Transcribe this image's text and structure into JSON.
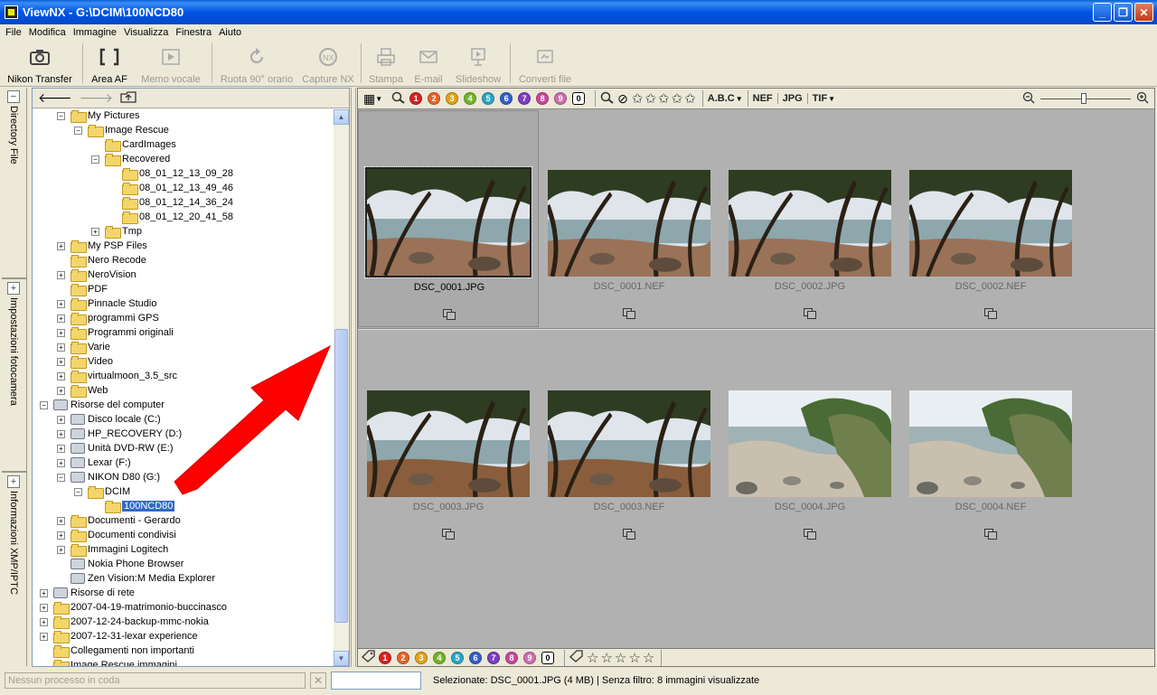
{
  "window": {
    "title": "ViewNX - G:\\DCIM\\100NCD80"
  },
  "menu": [
    "File",
    "Modifica",
    "Immagine",
    "Visualizza",
    "Finestra",
    "Aiuto"
  ],
  "toolbar": [
    {
      "label": "Nikon Transfer",
      "icon": "camera-icon",
      "enabled": true
    },
    {
      "label": "Area AF",
      "icon": "af-brackets-icon",
      "enabled": true
    },
    {
      "label": "Memo vocale",
      "icon": "voice-memo-icon",
      "enabled": false
    },
    {
      "label": "Ruota 90° orario",
      "icon": "rotate-icon",
      "enabled": false
    },
    {
      "label": "Capture NX",
      "icon": "capture-nx-icon",
      "enabled": false
    },
    {
      "label": "Stampa",
      "icon": "print-icon",
      "enabled": false
    },
    {
      "label": "E-mail",
      "icon": "email-icon",
      "enabled": false
    },
    {
      "label": "Slideshow",
      "icon": "slideshow-icon",
      "enabled": false
    },
    {
      "label": "Converti file",
      "icon": "convert-icon",
      "enabled": false
    }
  ],
  "left_tabs": [
    "Directory File",
    "Impostazioni fotocamera",
    "Informazioni XMP/IPTC"
  ],
  "tree": [
    {
      "label": "My Pictures",
      "level": 1,
      "exp": "-",
      "type": "folder"
    },
    {
      "label": "Image Rescue",
      "level": 2,
      "exp": "-",
      "type": "folder"
    },
    {
      "label": "CardImages",
      "level": 3,
      "exp": "",
      "type": "folder"
    },
    {
      "label": "Recovered",
      "level": 3,
      "exp": "-",
      "type": "folder"
    },
    {
      "label": "08_01_12_13_09_28",
      "level": 4,
      "exp": "",
      "type": "folder"
    },
    {
      "label": "08_01_12_13_49_46",
      "level": 4,
      "exp": "",
      "type": "folder"
    },
    {
      "label": "08_01_12_14_36_24",
      "level": 4,
      "exp": "",
      "type": "folder"
    },
    {
      "label": "08_01_12_20_41_58",
      "level": 4,
      "exp": "",
      "type": "folder"
    },
    {
      "label": "Tmp",
      "level": 3,
      "exp": "+",
      "type": "folder"
    },
    {
      "label": "My PSP Files",
      "level": 1,
      "exp": "+",
      "type": "folder"
    },
    {
      "label": "Nero Recode",
      "level": 1,
      "exp": "",
      "type": "folder"
    },
    {
      "label": "NeroVision",
      "level": 1,
      "exp": "+",
      "type": "folder"
    },
    {
      "label": "PDF",
      "level": 1,
      "exp": "",
      "type": "folder"
    },
    {
      "label": "Pinnacle Studio",
      "level": 1,
      "exp": "+",
      "type": "folder"
    },
    {
      "label": "programmi GPS",
      "level": 1,
      "exp": "+",
      "type": "folder"
    },
    {
      "label": "Programmi originali",
      "level": 1,
      "exp": "+",
      "type": "folder"
    },
    {
      "label": "Varie",
      "level": 1,
      "exp": "+",
      "type": "folder"
    },
    {
      "label": "Video",
      "level": 1,
      "exp": "+",
      "type": "folder"
    },
    {
      "label": "virtualmoon_3.5_src",
      "level": 1,
      "exp": "+",
      "type": "folder"
    },
    {
      "label": "Web",
      "level": 1,
      "exp": "+",
      "type": "folder"
    },
    {
      "label": "Risorse del computer",
      "level": 0,
      "exp": "-",
      "type": "drive"
    },
    {
      "label": "Disco locale (C:)",
      "level": 1,
      "exp": "+",
      "type": "drive"
    },
    {
      "label": "HP_RECOVERY (D:)",
      "level": 1,
      "exp": "+",
      "type": "drive"
    },
    {
      "label": "Unità DVD-RW (E:)",
      "level": 1,
      "exp": "+",
      "type": "drive"
    },
    {
      "label": "Lexar (F:)",
      "level": 1,
      "exp": "+",
      "type": "drive"
    },
    {
      "label": "NIKON D80 (G:)",
      "level": 1,
      "exp": "-",
      "type": "drive"
    },
    {
      "label": "DCIM",
      "level": 2,
      "exp": "-",
      "type": "folder"
    },
    {
      "label": "100NCD80",
      "level": 3,
      "exp": "",
      "type": "folder",
      "selected": true
    },
    {
      "label": "Documenti - Gerardo",
      "level": 1,
      "exp": "+",
      "type": "folder"
    },
    {
      "label": "Documenti condivisi",
      "level": 1,
      "exp": "+",
      "type": "folder"
    },
    {
      "label": "Immagini Logitech",
      "level": 1,
      "exp": "+",
      "type": "folder"
    },
    {
      "label": "Nokia Phone Browser",
      "level": 1,
      "exp": "",
      "type": "drive"
    },
    {
      "label": "Zen Vision:M Media Explorer",
      "level": 1,
      "exp": "",
      "type": "drive"
    },
    {
      "label": "Risorse di rete",
      "level": 0,
      "exp": "+",
      "type": "drive"
    },
    {
      "label": "2007-04-19-matrimonio-buccinasco",
      "level": 0,
      "exp": "+",
      "type": "folder"
    },
    {
      "label": "2007-12-24-backup-mmc-nokia",
      "level": 0,
      "exp": "+",
      "type": "folder"
    },
    {
      "label": "2007-12-31-lexar experience",
      "level": 0,
      "exp": "+",
      "type": "folder"
    },
    {
      "label": "Collegamenti non importanti",
      "level": 0,
      "exp": "",
      "type": "folder"
    },
    {
      "label": "Image Rescue immagini",
      "level": 0,
      "exp": "",
      "type": "folder"
    }
  ],
  "viewer_toolbar": {
    "labels": [
      "1",
      "2",
      "3",
      "4",
      "5",
      "6",
      "7",
      "8",
      "9",
      "0"
    ],
    "label_colors": [
      "#d42323",
      "#e8642b",
      "#e3a21a",
      "#74b42a",
      "#2aa5c9",
      "#3460c9",
      "#7a3fc2",
      "#c9489e",
      "#cf6fb0",
      "#ffffff"
    ],
    "sort_label": "A.B.C",
    "types": [
      "NEF",
      "JPG",
      "TIF"
    ]
  },
  "thumbnails": [
    {
      "name": "DSC_0001.JPG",
      "scene": "trees",
      "selected": true
    },
    {
      "name": "DSC_0001.NEF",
      "scene": "trees",
      "selected": false
    },
    {
      "name": "DSC_0002.JPG",
      "scene": "trees",
      "selected": false
    },
    {
      "name": "DSC_0002.NEF",
      "scene": "trees",
      "selected": false
    },
    {
      "name": "DSC_0003.JPG",
      "scene": "trees2",
      "selected": false
    },
    {
      "name": "DSC_0003.NEF",
      "scene": "trees2",
      "selected": false
    },
    {
      "name": "DSC_0004.JPG",
      "scene": "rocks",
      "selected": false
    },
    {
      "name": "DSC_0004.NEF",
      "scene": "rocks",
      "selected": false
    }
  ],
  "status": {
    "queue": "Nessun processo in coda",
    "info": "Selezionate: DSC_0001.JPG (4 MB) | Senza filtro: 8 immagini visualizzate"
  }
}
